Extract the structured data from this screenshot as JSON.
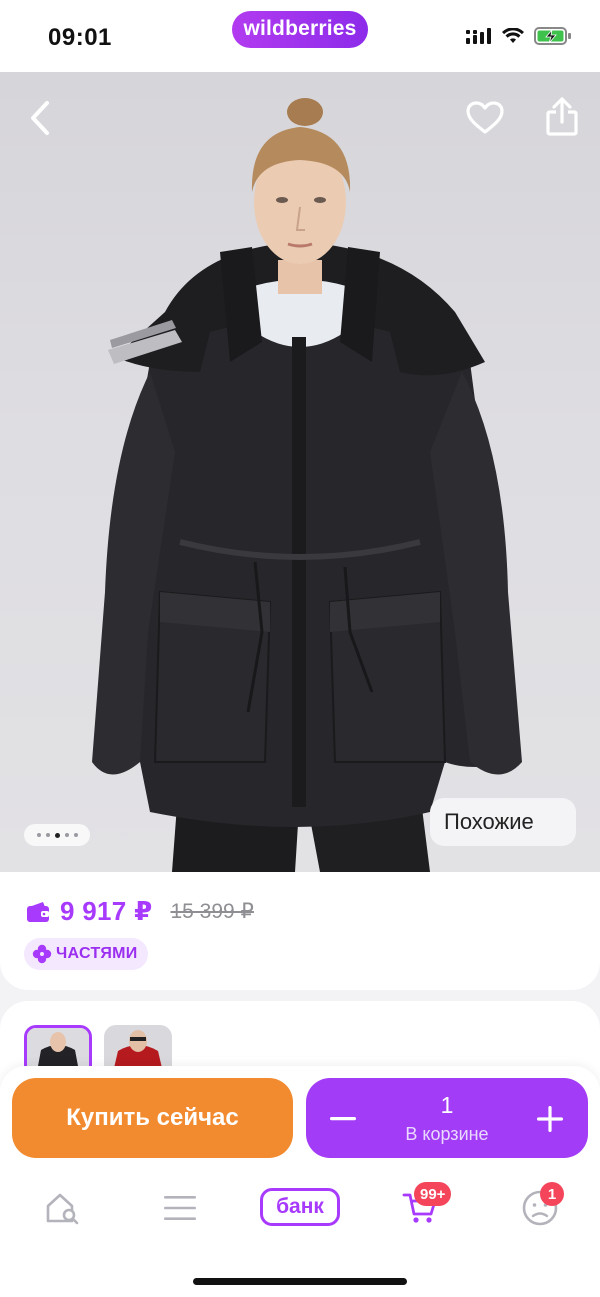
{
  "status_bar": {
    "time": "09:01",
    "brand": "wildberries",
    "icons": [
      "signal-icon",
      "wifi-icon",
      "battery-charging-icon"
    ]
  },
  "product_gallery": {
    "image_alt": "Woman wearing black parka with hood",
    "similar_label": "Похожие",
    "pages": 5,
    "current_page": 3,
    "icons": [
      "chevron-left-icon",
      "heart-icon",
      "share-icon"
    ]
  },
  "price": {
    "current": "9 917 ₽",
    "old": "15 399 ₽",
    "installments_label": "ЧАСТЯМИ",
    "icon": "wallet-icon"
  },
  "colors": {
    "variants": [
      "black",
      "red"
    ]
  },
  "actions": {
    "buy_now": "Купить сейчас",
    "quantity": "1",
    "in_cart_label": "В корзине"
  },
  "tabbar": {
    "bank_label": "банк",
    "cart_badge": "99+",
    "profile_badge": "1",
    "icons": [
      "home-search-icon",
      "menu-icon",
      "cart-icon",
      "profile-icon"
    ]
  },
  "colors_theme": {
    "accent": "#a73afd",
    "buy_button": "#f28b30",
    "badge": "#f4455b"
  }
}
